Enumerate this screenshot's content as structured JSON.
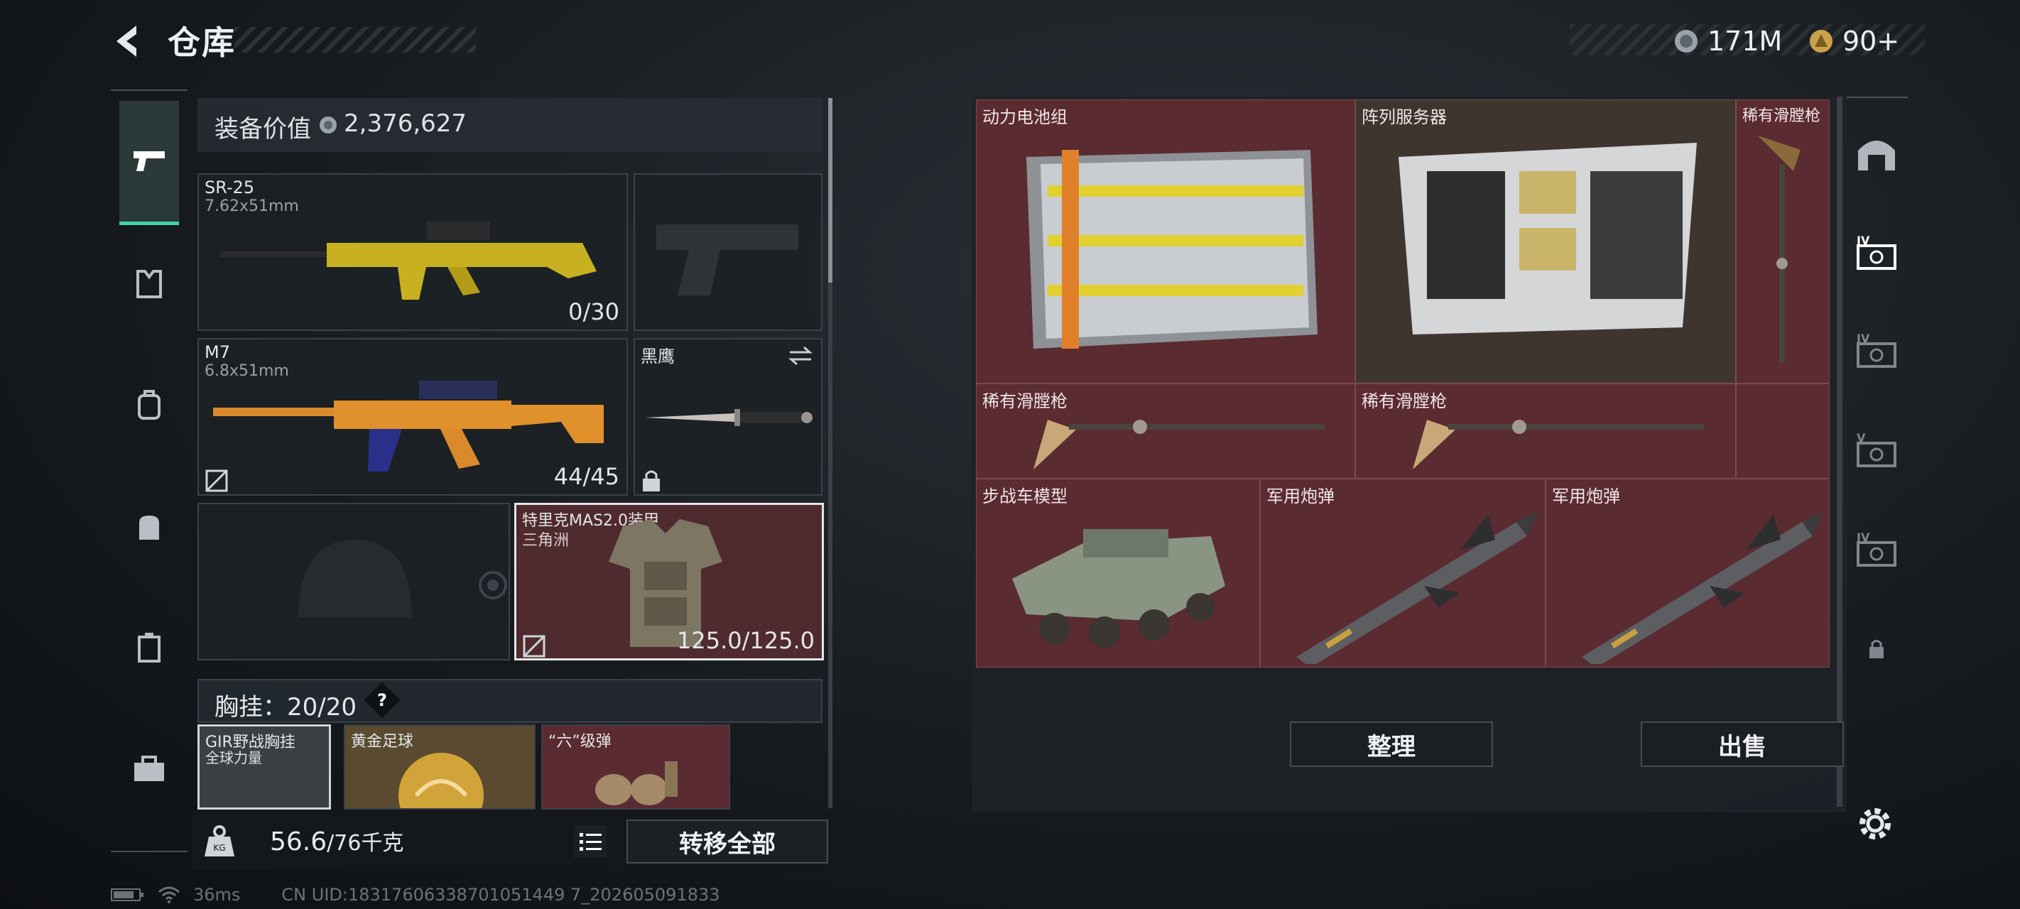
{
  "header": {
    "title": "仓库",
    "currency_1": "171M",
    "currency_2": "90+"
  },
  "left_nav": {
    "items": [
      "weapon-icon",
      "armor-icon",
      "backpack-icon",
      "bag-icon",
      "case-icon",
      "toolbox-icon"
    ]
  },
  "equipment": {
    "value_label": "装备价值",
    "value": "2,376,627",
    "slots": [
      {
        "name": "SR-25",
        "caliber": "7.62x51mm",
        "count": "0/30"
      },
      {
        "name": "M7",
        "caliber": "6.8x51mm",
        "count": "44/45"
      },
      {
        "name": "黑鹰"
      },
      {
        "name": "特里克MAS2.0装甲",
        "sub": "三角洲",
        "count": "125.0/125.0"
      }
    ],
    "rig_label": "胸挂：",
    "rig_count": "20/20",
    "rig_help": "?",
    "rig_items": [
      {
        "name": "GIR野战胸挂",
        "sub": "全球力量"
      },
      {
        "name": "黄金足球"
      },
      {
        "name": "“六”级弹"
      }
    ]
  },
  "weight": {
    "current": "56.6",
    "max": "/76千克",
    "transfer_label": "转移全部"
  },
  "status": {
    "ping": "36ms",
    "uid": "CN UID:18317606338701051449 7_202605091833"
  },
  "storage": {
    "items": [
      {
        "name": "动力电池组"
      },
      {
        "name": "阵列服务器"
      },
      {
        "name": "稀有滑膛枪"
      },
      {
        "name": "稀有滑膛枪"
      },
      {
        "name": "稀有滑膛枪"
      },
      {
        "name": "步战车模型"
      },
      {
        "name": "军用炮弹"
      },
      {
        "name": "军用炮弹"
      }
    ],
    "organize_label": "整理",
    "sell_label": "出售"
  },
  "colors": {
    "accent": "#3ed4a6",
    "cell_bg": "#5a2b30",
    "panel_bg": "#1c2126"
  }
}
